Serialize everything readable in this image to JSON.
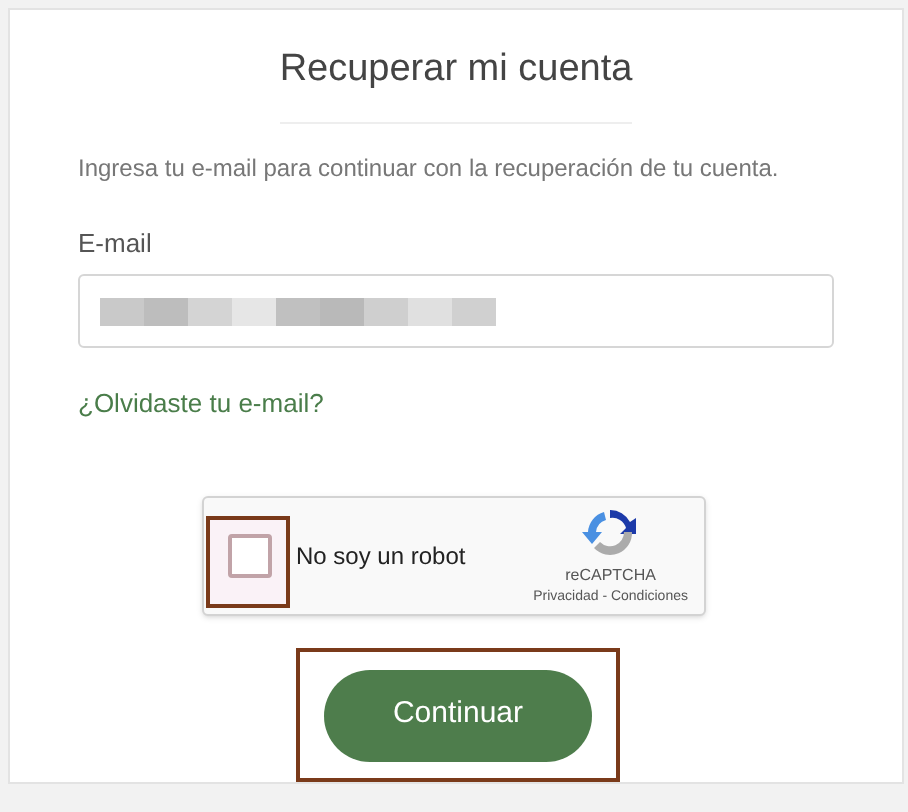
{
  "title": "Recuperar mi cuenta",
  "intro": "Ingresa tu e-mail para continuar con la recuperación de tu cuenta.",
  "email": {
    "label": "E-mail",
    "redacted": true
  },
  "forgot_link": "¿Olvidaste tu e-mail?",
  "captcha": {
    "label": "No soy un robot",
    "checked": false,
    "brand": "reCAPTCHA",
    "links": "Privacidad - Condiciones"
  },
  "submit": "Continuar"
}
